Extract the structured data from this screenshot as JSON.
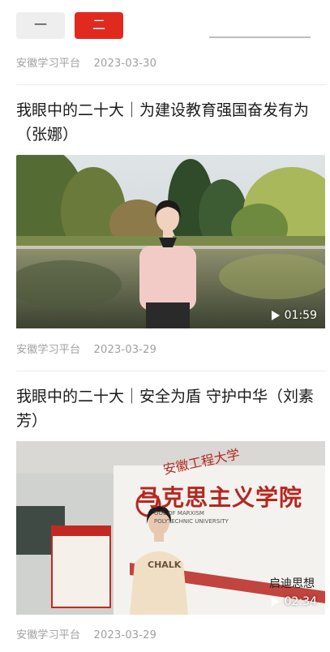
{
  "tabs": [
    {
      "label": "一"
    },
    {
      "label": "二"
    }
  ],
  "articles": [
    {
      "source": "安徽学习平台",
      "date": "2023-03-30"
    },
    {
      "title": "我眼中的二十大｜为建设教育强国奋发有为（张娜）",
      "duration": "01:59",
      "source": "安徽学习平台",
      "date": "2023-03-29"
    },
    {
      "title": "我眼中的二十大｜安全为盾 守护中华（刘素芳）",
      "duration": "02:34",
      "source": "安徽学习平台",
      "date": "2023-03-29",
      "wall_text": {
        "calligraphy": "安徽工程大学",
        "main": "马克思主义学院",
        "english_1": "OOL OF MARXISM",
        "english_2": "POLYTECHNIC UNIVERSITY",
        "side": "启迪思想"
      },
      "shirt_text": "CHALK"
    }
  ],
  "colors": {
    "accent": "#e02a1f",
    "meta_text": "#a0a0a0"
  }
}
